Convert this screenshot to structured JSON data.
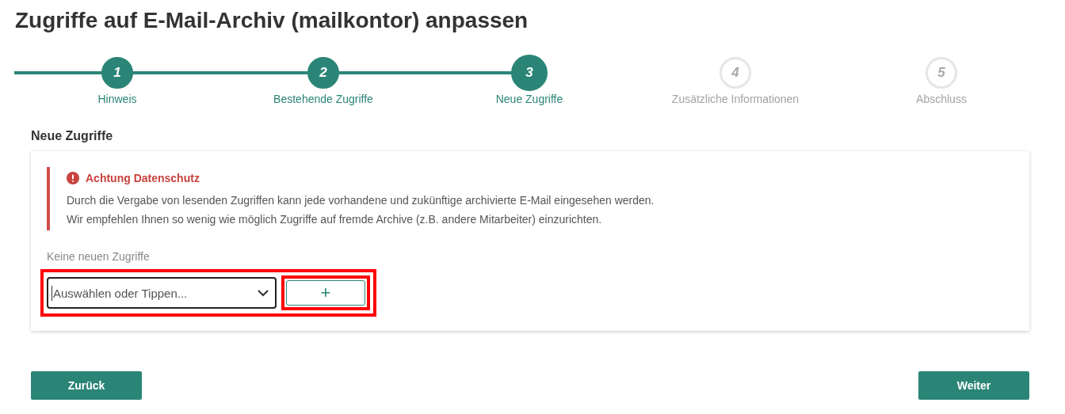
{
  "title": "Zugriffe auf E-Mail-Archiv (mailkontor) anpassen",
  "steps": [
    {
      "number": "1",
      "label": "Hinweis",
      "reached": true,
      "selected": false
    },
    {
      "number": "2",
      "label": "Bestehende Zugriffe",
      "reached": true,
      "selected": false
    },
    {
      "number": "3",
      "label": "Neue Zugriffe",
      "reached": true,
      "selected": true
    },
    {
      "number": "4",
      "label": "Zusätzliche Informationen",
      "reached": false,
      "selected": false
    },
    {
      "number": "5",
      "label": "Abschluss",
      "reached": false,
      "selected": false
    }
  ],
  "section_title": "Neue Zugriffe",
  "alert": {
    "title": "Achtung Datenschutz",
    "lines": [
      "Durch die Vergabe von lesenden Zugriffen kann jede vorhandene und zukünftige archivierte E-Mail eingesehen werden.",
      "Wir empfehlen Ihnen so wenig wie möglich Zugriffe auf fremde Archive (z.B. andere Mitarbeiter) einzurichten."
    ]
  },
  "empty_text": "Keine neuen Zugriffe",
  "select": {
    "placeholder": "Auswählen oder Tippen...",
    "highlighted": true
  },
  "add_button": {
    "label": "+",
    "highlighted": true
  },
  "buttons": {
    "back": "Zurück",
    "next": "Weiter"
  }
}
